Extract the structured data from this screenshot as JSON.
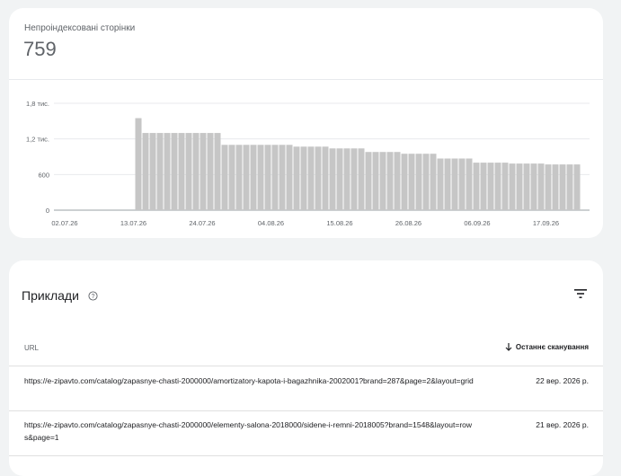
{
  "summary": {
    "label": "Непроіндексовані сторінки",
    "value": "759"
  },
  "chart_data": {
    "type": "bar",
    "y_ticks": [
      "0",
      "600",
      "1,2 тис.",
      "1,8 тис."
    ],
    "x_ticks": [
      "02.07.26",
      "13.07.26",
      "24.07.26",
      "04.08.26",
      "15.08.26",
      "26.08.26",
      "06.09.26",
      "17.09.26"
    ],
    "ylim": [
      0,
      1800
    ],
    "bar_color": "#c6c6c6",
    "values": [
      0,
      0,
      0,
      0,
      0,
      0,
      0,
      0,
      0,
      0,
      0,
      1550,
      1300,
      1300,
      1300,
      1300,
      1300,
      1300,
      1300,
      1300,
      1300,
      1300,
      1300,
      1100,
      1100,
      1100,
      1100,
      1100,
      1100,
      1100,
      1100,
      1100,
      1100,
      1070,
      1070,
      1070,
      1070,
      1070,
      1040,
      1040,
      1040,
      1040,
      1040,
      980,
      980,
      980,
      980,
      980,
      950,
      950,
      950,
      950,
      950,
      870,
      870,
      870,
      870,
      870,
      800,
      800,
      800,
      800,
      800,
      785,
      785,
      785,
      785,
      785,
      770,
      770,
      770,
      770,
      770
    ]
  },
  "examples": {
    "title": "Приклади",
    "column_url": "URL",
    "column_sort": "Останнє сканування",
    "rows": [
      {
        "url": "https://e-zipavto.com/catalog/zapasnye-chasti-2000000/amortizatory-kapota-i-bagazhnika-2002001?brand=287&page=2&layout=grid",
        "date": "22 вер. 2026 р."
      },
      {
        "url": "https://e-zipavto.com/catalog/zapasnye-chasti-2000000/elementy-salona-2018000/sidene-i-remni-2018005?brand=1548&layout=rows&page=1",
        "date": "21 вер. 2026 р."
      }
    ]
  }
}
